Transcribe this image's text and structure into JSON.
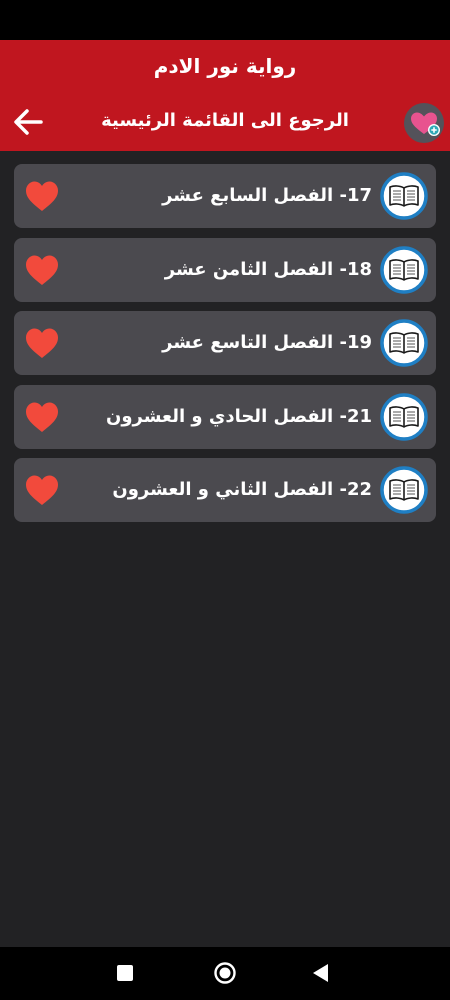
{
  "header": {
    "app_title": "رواية نور الادم",
    "back_label": "الرجوع الى القائمة الرئيسية"
  },
  "chapters": [
    {
      "label": "17- الفصل السابع عشر"
    },
    {
      "label": "18- الفصل الثامن عشر"
    },
    {
      "label": "19- الفصل التاسع عشر"
    },
    {
      "label": "21- الفصل الحادي و العشرون"
    },
    {
      "label": "22- الفصل الثاني و العشرون"
    }
  ],
  "icons": {
    "back": "arrow-left-icon",
    "favorites": "heart-plus-icon",
    "chapter": "open-book-icon",
    "favorite": "heart-icon",
    "nav_recents": "square-icon",
    "nav_home": "circle-icon",
    "nav_back": "triangle-icon"
  },
  "colors": {
    "app_bar": "#c0161f",
    "background": "#222224",
    "card": "#4b4a4f",
    "heart": "#f24a3c",
    "book_ring": "#1f7fc4"
  }
}
